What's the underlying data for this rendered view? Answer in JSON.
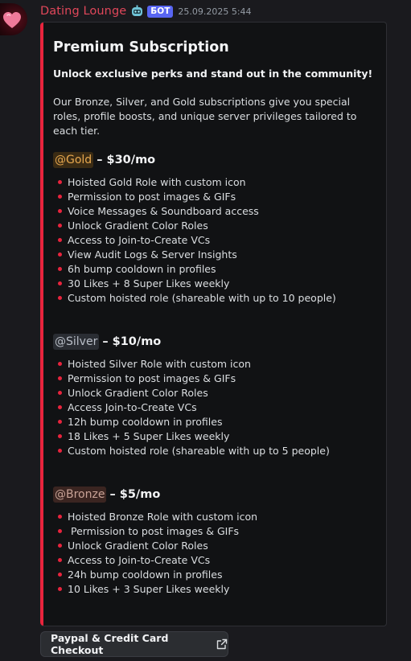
{
  "message": {
    "username": "Dating Lounge",
    "bot_tag": "БОТ",
    "timestamp": "25.09.2025 5:44",
    "avatar_icon": "heart-icon",
    "username_emoji": "robot-face-icon",
    "colors": {
      "username": "#e0475a",
      "accent_bar": "#e8243d",
      "bot_tag": "#5865f2"
    }
  },
  "embed": {
    "title": "Premium Subscription",
    "lead": "Unlock exclusive perks and stand out in the community!",
    "description": "Our Bronze, Silver, and Gold subscriptions give you special roles, profile boosts, and unique server privileges tailored to each tier.",
    "tiers": [
      {
        "mention": "@Gold",
        "price": "– $30/mo",
        "perks": [
          "Hoisted Gold Role with custom icon",
          "Permission to post images & GIFs",
          "Voice Messages & Soundboard access",
          "Unlock Gradient Color Roles",
          "Access to Join-to-Create VCs",
          "View Audit Logs & Server Insights",
          "6h bump cooldown in profiles",
          "30 Likes + 8 Super Likes weekly",
          "Custom hoisted role (shareable with up to 10 people)"
        ]
      },
      {
        "mention": "@Silver",
        "price": "– $10/mo",
        "perks": [
          "Hoisted Silver Role with custom icon",
          "Permission to post images & GIFs",
          "Unlock Gradient Color Roles",
          "Access Join-to-Create VCs",
          "12h bump cooldown in profiles",
          "18 Likes + 5 Super Likes weekly",
          "Custom hoisted role (shareable with up to 5 people)"
        ]
      },
      {
        "mention": "@Bronze",
        "price": "– $5/mo",
        "perks": [
          "Hoisted Bronze Role with custom icon",
          " Permission to post images & GIFs",
          "Unlock Gradient Color Roles",
          "Access to Join-to-Create VCs",
          "24h bump cooldown in profiles",
          "10 Likes + 3 Super Likes weekly"
        ]
      }
    ]
  },
  "checkout_button": {
    "label": "Paypal & Credit Card Checkout",
    "icon": "external-link-icon"
  }
}
